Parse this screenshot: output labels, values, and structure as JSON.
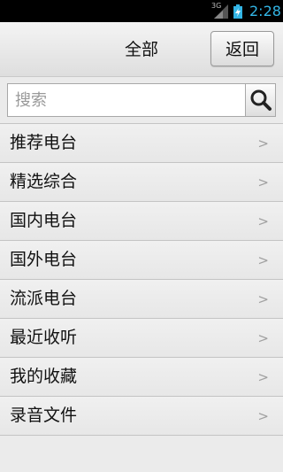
{
  "status_bar": {
    "network": "3G",
    "time": "2:28",
    "accent_color": "#33b5e5"
  },
  "header": {
    "title": "全部",
    "back_label": "返回"
  },
  "search": {
    "placeholder": "搜索",
    "icon": "search-icon"
  },
  "menu": {
    "items": [
      {
        "label": "推荐电台",
        "chevron": ">"
      },
      {
        "label": "精选综合",
        "chevron": ">"
      },
      {
        "label": "国内电台",
        "chevron": ">"
      },
      {
        "label": "国外电台",
        "chevron": ">"
      },
      {
        "label": "流派电台",
        "chevron": ">"
      },
      {
        "label": "最近收听",
        "chevron": ">"
      },
      {
        "label": "我的收藏",
        "chevron": ">"
      },
      {
        "label": "录音文件",
        "chevron": ">"
      }
    ]
  }
}
